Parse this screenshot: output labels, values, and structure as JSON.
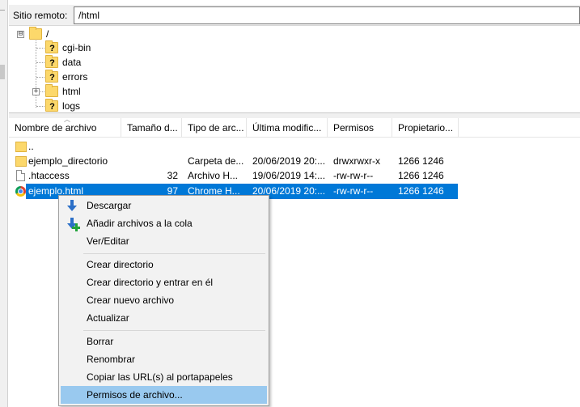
{
  "remote_site": {
    "label": "Sitio remoto:",
    "path": "/html"
  },
  "tree": {
    "root": {
      "label": "/",
      "expander": "⊟"
    },
    "children": [
      {
        "label": "cgi-bin",
        "icon": "question-folder-icon"
      },
      {
        "label": "data",
        "icon": "question-folder-icon"
      },
      {
        "label": "errors",
        "icon": "question-folder-icon"
      },
      {
        "label": "html",
        "icon": "folder-icon",
        "expander": "+"
      },
      {
        "label": "logs",
        "icon": "question-folder-icon"
      }
    ]
  },
  "file_list": {
    "columns": [
      "Nombre de archivo",
      "Tamaño d...",
      "Tipo de arc...",
      "Última modific...",
      "Permisos",
      "Propietario..."
    ],
    "rows": [
      {
        "name": "..",
        "size": "",
        "type": "",
        "modified": "",
        "perms": "",
        "owner": "",
        "icon": "folder-icon"
      },
      {
        "name": "ejemplo_directorio",
        "size": "",
        "type": "Carpeta de...",
        "modified": "20/06/2019 20:...",
        "perms": "drwxrwxr-x",
        "owner": "1266 1246",
        "icon": "folder-icon"
      },
      {
        "name": ".htaccess",
        "size": "32",
        "type": "Archivo H...",
        "modified": "19/06/2019 14:...",
        "perms": "-rw-rw-r--",
        "owner": "1266 1246",
        "icon": "file-icon"
      },
      {
        "name": "ejemplo.html",
        "size": "97",
        "type": "Chrome H...",
        "modified": "20/06/2019 20:...",
        "perms": "-rw-rw-r--",
        "owner": "1266 1246",
        "icon": "chrome-icon",
        "selected": true
      }
    ]
  },
  "context_menu": {
    "items": [
      {
        "label": "Descargar",
        "icon": "download-icon"
      },
      {
        "label": "Añadir archivos a la cola",
        "icon": "add-to-queue-icon"
      },
      {
        "label": "Ver/Editar"
      },
      {
        "label": "Crear directorio"
      },
      {
        "label": "Crear directorio y entrar en él"
      },
      {
        "label": "Crear nuevo archivo"
      },
      {
        "label": "Actualizar"
      },
      {
        "label": "Borrar"
      },
      {
        "label": "Renombrar"
      },
      {
        "label": "Copiar las URL(s) al portapapeles"
      },
      {
        "label": "Permisos de archivo...",
        "highlighted": true
      }
    ]
  },
  "colors": {
    "selection": "#0078d7",
    "menu_highlight": "#99c9ef",
    "folder": "#fcd86b"
  }
}
